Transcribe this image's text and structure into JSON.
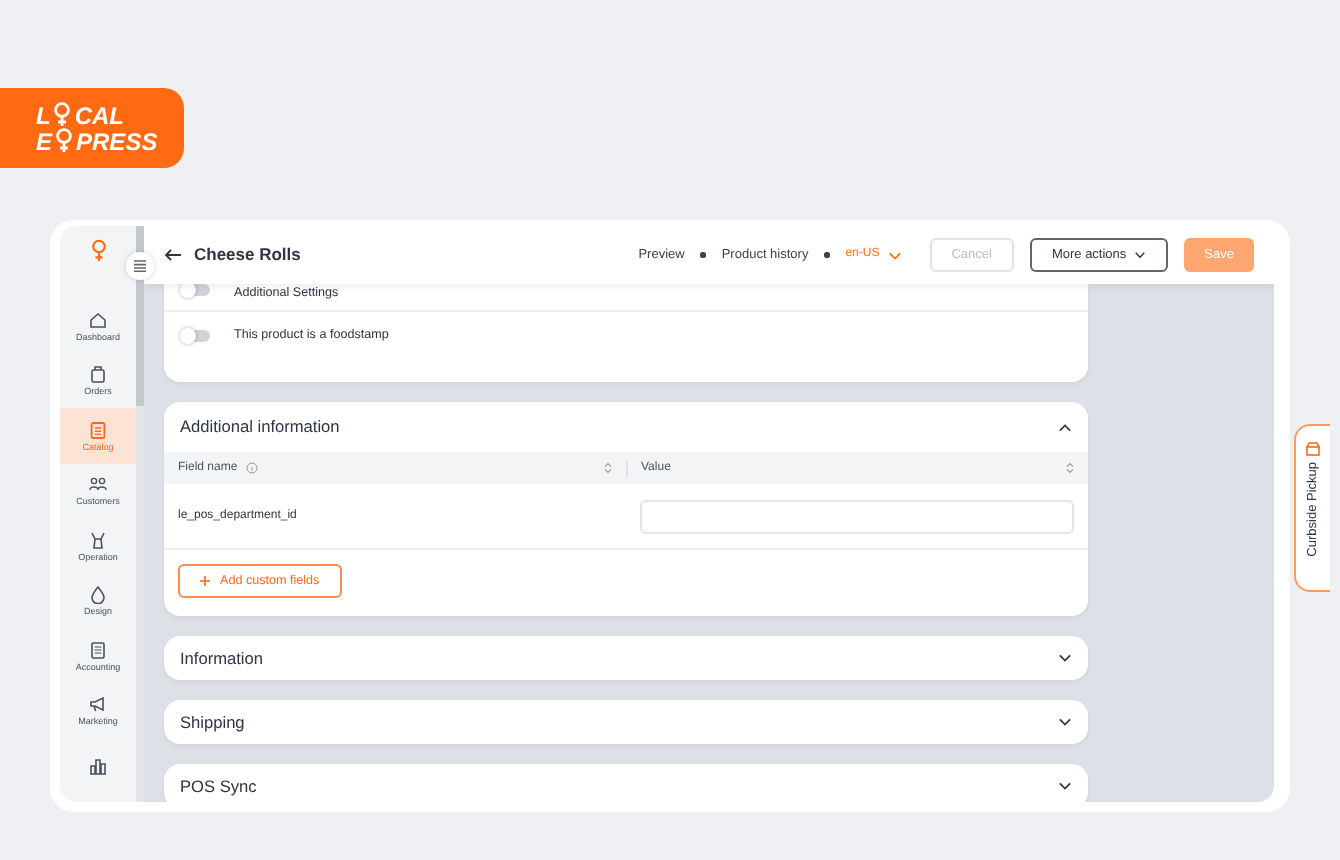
{
  "logo": {
    "line_1": [
      "L",
      "CAL"
    ],
    "line_2": [
      "E",
      "PRESS"
    ]
  },
  "sidebar": {
    "items": [
      {
        "label": "Dashboard",
        "selected": false
      },
      {
        "label": "Orders",
        "selected": false
      },
      {
        "label": "Catalog",
        "selected": true
      },
      {
        "label": "Customers",
        "selected": false
      },
      {
        "label": "Operation",
        "selected": false
      },
      {
        "label": "Design",
        "selected": false
      },
      {
        "label": "Accounting",
        "selected": false
      },
      {
        "label": "Marketing",
        "selected": false
      },
      {
        "selected": false
      }
    ]
  },
  "header": {
    "title": "Cheese Rolls",
    "links": [
      "Preview",
      "Product history"
    ],
    "language": "en-US",
    "buttons": [
      {
        "label": "Cancel",
        "kind": "outline",
        "disabled": true
      },
      {
        "label": "More actions",
        "kind": "dropdown",
        "disabled": false
      },
      {
        "label": "Save",
        "kind": "primary",
        "disabled": true
      }
    ]
  },
  "toggles": [
    {
      "label": "Additional Settings",
      "on": false
    },
    {
      "label": "This product is a foodstamp",
      "on": false
    }
  ],
  "additional_information": {
    "title": "Additional information",
    "expanded": true,
    "columns": [
      "Field name",
      "Value"
    ],
    "rows": [
      {
        "field_name": "le_pos_department_id",
        "value": ""
      }
    ],
    "add_button": "Add custom fields"
  },
  "sections": [
    {
      "title": "Information",
      "expanded": false
    },
    {
      "title": "Shipping",
      "expanded": false
    },
    {
      "title": "POS Sync",
      "expanded": false
    }
  ],
  "side_tab": {
    "label": "Curbside Pickup"
  }
}
